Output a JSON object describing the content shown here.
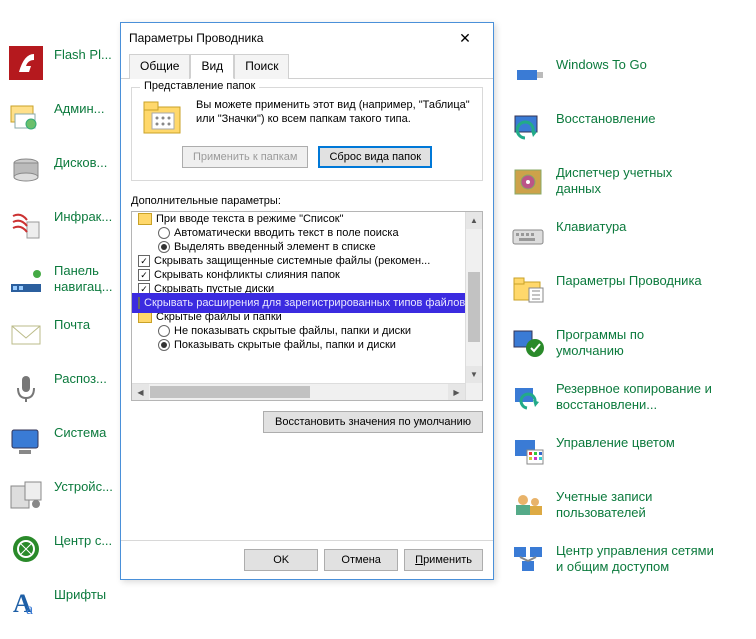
{
  "cp_left": [
    {
      "name": "flash-player",
      "label": "Flash Pl..."
    },
    {
      "name": "administration",
      "label": "Админ..."
    },
    {
      "name": "disk-spaces",
      "label": "Дисков..."
    },
    {
      "name": "infrared",
      "label": "Инфрак..."
    },
    {
      "name": "taskbar-nav",
      "label": "Панель\nнавигац..."
    },
    {
      "name": "mail",
      "label": "Почта"
    },
    {
      "name": "recognition",
      "label": "Распоз..."
    },
    {
      "name": "system",
      "label": "Система"
    },
    {
      "name": "devices",
      "label": "Устройс..."
    },
    {
      "name": "ease-of-access",
      "label": "Центр с..."
    },
    {
      "name": "fonts",
      "label": "Шрифты"
    }
  ],
  "cp_right": [
    {
      "name": "windows-to-go",
      "label": "Windows To Go"
    },
    {
      "name": "recovery",
      "label": "Восстановление"
    },
    {
      "name": "credential-manager",
      "label": "Диспетчер учетных\nданных"
    },
    {
      "name": "keyboard",
      "label": "Клавиатура"
    },
    {
      "name": "folder-options",
      "label": "Параметры Проводника"
    },
    {
      "name": "default-programs",
      "label": "Программы по\nумолчанию"
    },
    {
      "name": "backup-restore",
      "label": "Резервное копирование и\nвосстановлени..."
    },
    {
      "name": "color-management",
      "label": "Управление цветом"
    },
    {
      "name": "user-accounts",
      "label": "Учетные записи\nпользователей"
    },
    {
      "name": "network-sharing",
      "label": "Центр управления сетями\nи общим доступом"
    }
  ],
  "dialog": {
    "title": "Параметры Проводника",
    "tabs": {
      "general": "Общие",
      "view": "Вид",
      "search": "Поиск"
    },
    "group_title": "Представление папок",
    "folder_text": "Вы можете применить этот вид (например, \"Таблица\" или \"Значки\") ко всем папкам такого типа.",
    "apply_folders": "Применить к папкам",
    "reset_folders": "Сброс вида папок",
    "advanced_label": "Дополнительные параметры:",
    "restore_defaults": "Восстановить значения по умолчанию",
    "ok": "OK",
    "cancel": "Отмена",
    "apply": "Применить",
    "list": {
      "parent": "При вводе текста в режиме \"Список\"",
      "r1": "Автоматически вводить текст в поле поиска",
      "r2": "Выделять введенный элемент в списке",
      "c1": "Скрывать защищенные системные файлы (рекомен...",
      "c2": "Скрывать конфликты слияния папок",
      "c3": "Скрывать пустые диски",
      "hl": "Скрывать расширения для зарегистрированных типов файлов",
      "parent2": "Скрытые файлы и папки",
      "r3": "Не показывать скрытые файлы, папки и диски",
      "r4": "Показывать скрытые файлы, папки и диски"
    }
  }
}
